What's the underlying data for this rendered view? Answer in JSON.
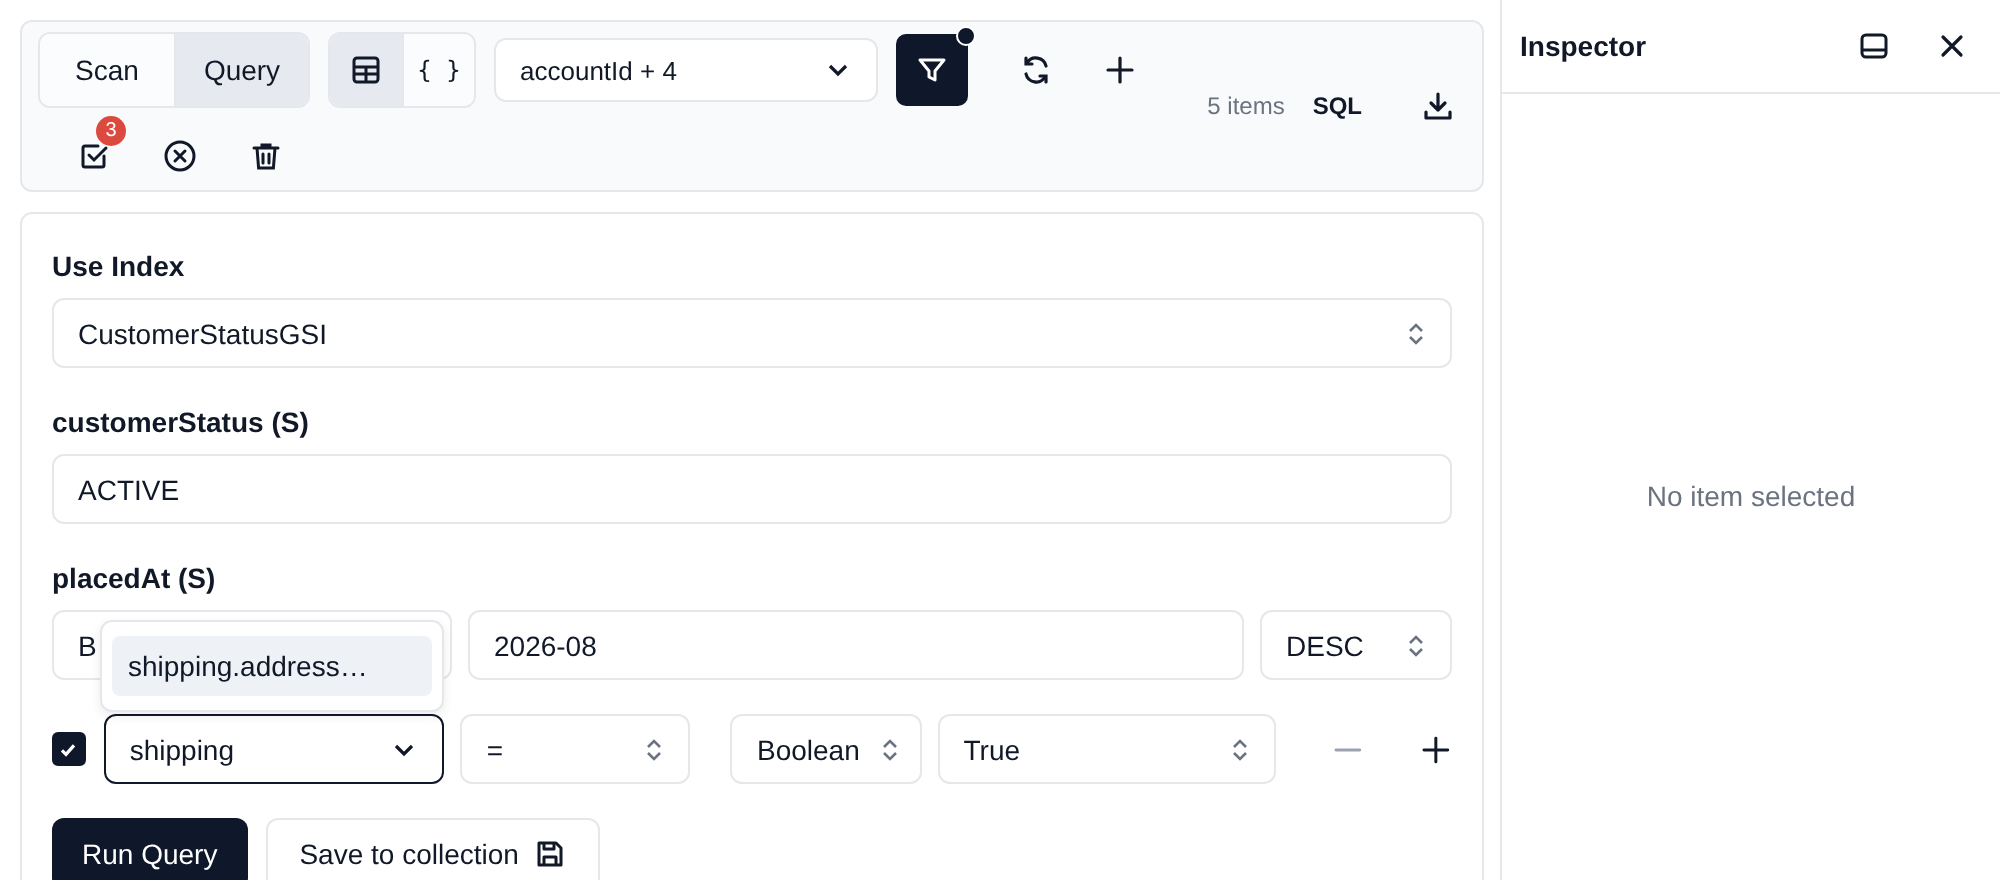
{
  "mode_tabs": [
    {
      "label": "Scan",
      "selected": false
    },
    {
      "label": "Query",
      "selected": true
    }
  ],
  "view_toggle": [
    {
      "kind": "table",
      "selected": true
    },
    {
      "kind": "json",
      "label": "{ }",
      "selected": false
    }
  ],
  "columns_select": {
    "value": "accountId + 4"
  },
  "toolbar": {
    "filter_active": true,
    "item_count": "5 items",
    "sql_label": "SQL",
    "selection_count": "3"
  },
  "query": {
    "index_label": "Use Index",
    "index_value": "CustomerStatusGSI",
    "partition_label": "customerStatus (S)",
    "partition_value": "ACTIVE",
    "sort_label": "placedAt (S)",
    "sort_condition": "B",
    "sort_value": "2026-08",
    "sort_order": "DESC"
  },
  "filters": [
    {
      "enabled": true,
      "field": "shipping",
      "focused": true,
      "operator": "=",
      "type": "Boolean",
      "value": "True",
      "remove_disabled": true
    }
  ],
  "suggestions": [
    "shipping.address…"
  ],
  "actions": {
    "run": "Run Query",
    "save": "Save to collection"
  },
  "inspector": {
    "title": "Inspector",
    "empty": "No item selected"
  }
}
